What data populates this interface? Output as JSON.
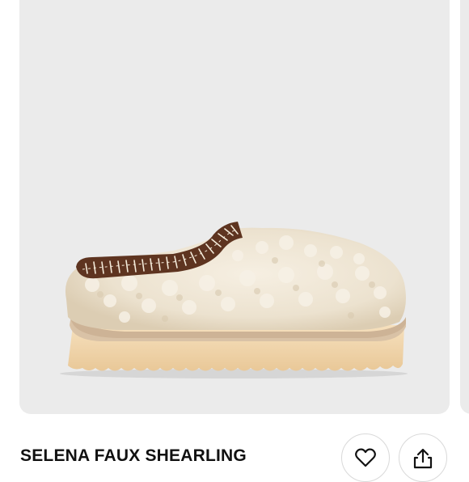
{
  "product": {
    "title": "SELENA FAUX SHEARLING",
    "image": {
      "icon": "slipper-product-image"
    }
  },
  "actions": {
    "like_icon": "heart-icon",
    "share_icon": "share-upload-icon"
  },
  "colors": {
    "card_background": "#ebebeb",
    "shearling": "#ede3d2",
    "sole": "#f1d6ad",
    "trim": "#5e3420"
  }
}
